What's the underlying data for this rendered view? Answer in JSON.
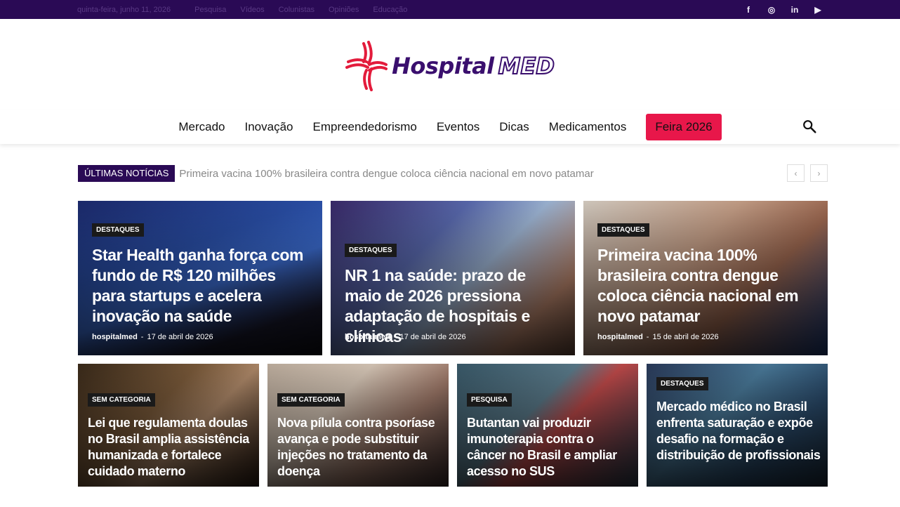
{
  "topbar": {
    "date": "quinta-feira, junho 11, 2026",
    "links": [
      "Pesquisa",
      "Vídeos",
      "Colunistas",
      "Opiniões",
      "Educação"
    ],
    "social_icons": [
      "facebook-icon",
      "instagram-icon",
      "linkedin-icon",
      "youtube-icon"
    ],
    "social_glyphs": [
      "f",
      "◎",
      "in",
      "▶"
    ]
  },
  "logo": {
    "brand": "Hospital",
    "brand_sub": "MED"
  },
  "nav": {
    "items": [
      "Mercado",
      "Inovação",
      "Empreendedorismo",
      "Eventos",
      "Dicas",
      "Medicamentos"
    ],
    "feira": "Feira 2026"
  },
  "ticker": {
    "label": "ÚLTIMAS NOTÍCIAS",
    "headline": "Primeira vacina 100% brasileira contra dengue coloca ciência nacional em novo patamar",
    "prev": "‹",
    "next": "›"
  },
  "featured": [
    {
      "tag": "DESTAQUES",
      "title": "Star Health ganha força com fundo de R$ 120 milhões para startups e acelera inovação na saúde",
      "author": "hospitalmed",
      "sep": "-",
      "date": "17 de abril de 2026"
    },
    {
      "tag": "DESTAQUES",
      "title": "NR 1 na saúde: prazo de maio de 2026 pressiona adaptação de hospitais e clínicas",
      "author": "hospitalmed",
      "sep": "-",
      "date": "17 de abril de 2026"
    },
    {
      "tag": "DESTAQUES",
      "title": "Primeira vacina 100% brasileira contra dengue coloca ciência nacional em novo patamar",
      "author": "hospitalmed",
      "sep": "-",
      "date": "15 de abril de 2026"
    }
  ],
  "secondary": [
    {
      "tag": "SEM CATEGORIA",
      "title": "Lei que regulamenta doulas no Brasil amplia assistência humanizada e fortalece cuidado materno"
    },
    {
      "tag": "SEM CATEGORIA",
      "title": "Nova pílula contra psoríase avança e pode substituir injeções no tratamento da doença"
    },
    {
      "tag": "PESQUISA",
      "title": "Butantan vai produzir imunoterapia contra o câncer no Brasil e ampliar acesso no SUS"
    },
    {
      "tag": "DESTAQUES",
      "title": "Mercado médico no Brasil enfrenta saturação e expõe desafio na formação e distribuição de profissionais"
    }
  ],
  "colors": {
    "brand_purple": "#2a0a55",
    "accent_red": "#e8174a"
  }
}
